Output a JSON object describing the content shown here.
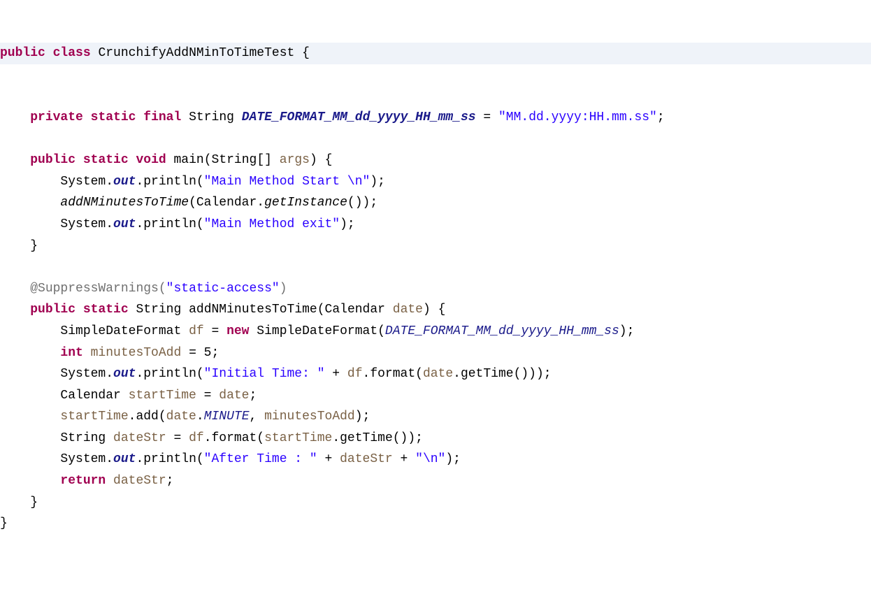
{
  "code": {
    "line1": {
      "public": "public",
      "class": "class",
      "classname": "CrunchifyAddNMinToTimeTest",
      "brace": " {"
    },
    "line3": {
      "private": "private",
      "static": "static",
      "final": "final",
      "type": "String",
      "field": "DATE_FORMAT_MM_dd_yyyy_HH_mm_ss",
      "eq": " = ",
      "value": "\"MM.dd.yyyy:HH.mm.ss\"",
      "semi": ";"
    },
    "line5": {
      "public": "public",
      "static": "static",
      "void": "void",
      "method": "main",
      "paren1": "(",
      "type": "String[]",
      "param": "args",
      "paren2": ") {"
    },
    "line6": {
      "obj": "System.",
      "out": "out",
      "method": ".println(",
      "str": "\"Main Method Start \\n\"",
      "end": ");"
    },
    "line7": {
      "method": "addNMinutesToTime",
      "paren1": "(Calendar.",
      "call": "getInstance",
      "paren2": "());"
    },
    "line8": {
      "obj": "System.",
      "out": "out",
      "method": ".println(",
      "str": "\"Main Method exit\"",
      "end": ");"
    },
    "line9": {
      "brace": "}"
    },
    "line11": {
      "annot": "@SuppressWarnings",
      "paren1": "(",
      "str": "\"static-access\"",
      "paren2": ")"
    },
    "line12": {
      "public": "public",
      "static": "static",
      "type": "String",
      "method": "addNMinutesToTime",
      "paren1": "(Calendar ",
      "param": "date",
      "paren2": ") {"
    },
    "line13": {
      "type": "SimpleDateFormat ",
      "var": "df",
      "eq": " = ",
      "new": "new",
      "ctor": " SimpleDateFormat(",
      "arg": "DATE_FORMAT_MM_dd_yyyy_HH_mm_ss",
      "end": ");"
    },
    "line14": {
      "int": "int",
      "var": " minutesToAdd",
      "eq": " = 5;"
    },
    "line15": {
      "obj": "System.",
      "out": "out",
      "method": ".println(",
      "str": "\"Initial Time: \"",
      "plus": " + ",
      "var1": "df",
      "call1": ".format(",
      "var2": "date",
      "call2": ".getTime()));"
    },
    "line16": {
      "type": "Calendar ",
      "var": "startTime",
      "eq": " = ",
      "var2": "date",
      "semi": ";"
    },
    "line17": {
      "var": "startTime",
      "call": ".add(",
      "var2": "date",
      "dot": ".",
      "field": "MINUTE",
      "comma": ", ",
      "var3": "minutesToAdd",
      "end": ");"
    },
    "line18": {
      "type": "String ",
      "var": "dateStr",
      "eq": " = ",
      "var2": "df",
      "call": ".format(",
      "var3": "startTime",
      "call2": ".getTime());"
    },
    "line19": {
      "obj": "System.",
      "out": "out",
      "method": ".println(",
      "str": "\"After Time : \"",
      "plus1": " + ",
      "var": "dateStr",
      "plus2": " + ",
      "str2": "\"\\n\"",
      "end": ");"
    },
    "line20": {
      "return": "return",
      "var": " dateStr",
      "semi": ";"
    },
    "line21": {
      "brace": "}"
    },
    "line22": {
      "brace": "}"
    }
  }
}
